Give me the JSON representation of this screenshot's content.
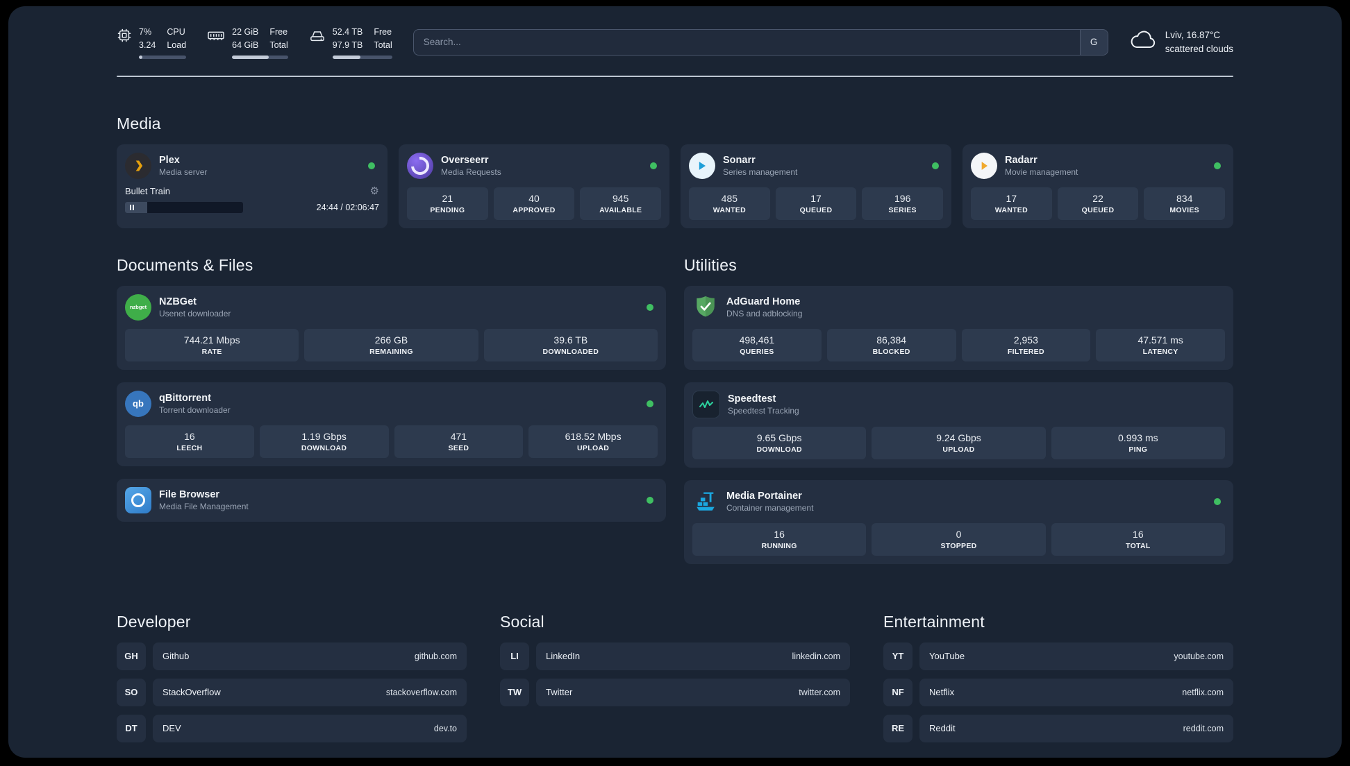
{
  "colors": {
    "page_bg": "#1a2433",
    "card_bg": "#242f41",
    "tile_bg": "#2d3a4e",
    "status_online": "#3fbf62",
    "plex_gold": "#e5a00d"
  },
  "header": {
    "cpu": {
      "percent": "7%",
      "load": "3.24",
      "col2_top": "CPU",
      "col2_bottom": "Load",
      "bar_percent": 7
    },
    "memory": {
      "free": "22 GiB",
      "total": "64 GiB",
      "col2_top": "Free",
      "col2_bottom": "Total",
      "bar_percent": 66
    },
    "disk": {
      "free": "52.4 TB",
      "total": "97.9 TB",
      "col2_top": "Free",
      "col2_bottom": "Total",
      "bar_percent": 47
    },
    "search": {
      "placeholder": "Search...",
      "provider_label": "G"
    },
    "weather": {
      "location": "Lviv, 16.87°C",
      "condition": "scattered clouds"
    }
  },
  "media": {
    "title": "Media",
    "plex": {
      "name": "Plex",
      "subtitle": "Media server",
      "now_playing": {
        "track": "Bullet Train",
        "time": "24:44 / 02:06:47",
        "progress_percent": 19
      }
    },
    "overseerr": {
      "name": "Overseerr",
      "subtitle": "Media Requests",
      "stats": [
        {
          "value": "21",
          "label": "PENDING"
        },
        {
          "value": "40",
          "label": "APPROVED"
        },
        {
          "value": "945",
          "label": "AVAILABLE"
        }
      ]
    },
    "sonarr": {
      "name": "Sonarr",
      "subtitle": "Series management",
      "stats": [
        {
          "value": "485",
          "label": "WANTED"
        },
        {
          "value": "17",
          "label": "QUEUED"
        },
        {
          "value": "196",
          "label": "SERIES"
        }
      ]
    },
    "radarr": {
      "name": "Radarr",
      "subtitle": "Movie management",
      "stats": [
        {
          "value": "17",
          "label": "WANTED"
        },
        {
          "value": "22",
          "label": "QUEUED"
        },
        {
          "value": "834",
          "label": "MOVIES"
        }
      ]
    }
  },
  "documents": {
    "title": "Documents & Files",
    "nzbget": {
      "name": "NZBGet",
      "subtitle": "Usenet downloader",
      "icon_text": "nzbget",
      "stats": [
        {
          "value": "744.21 Mbps",
          "label": "RATE"
        },
        {
          "value": "266 GB",
          "label": "REMAINING"
        },
        {
          "value": "39.6 TB",
          "label": "DOWNLOADED"
        }
      ]
    },
    "qbittorrent": {
      "name": "qBittorrent",
      "subtitle": "Torrent downloader",
      "icon_text": "qb",
      "stats": [
        {
          "value": "16",
          "label": "LEECH"
        },
        {
          "value": "1.19 Gbps",
          "label": "DOWNLOAD"
        },
        {
          "value": "471",
          "label": "SEED"
        },
        {
          "value": "618.52 Mbps",
          "label": "UPLOAD"
        }
      ]
    },
    "filebrowser": {
      "name": "File Browser",
      "subtitle": "Media File Management"
    }
  },
  "utilities": {
    "title": "Utilities",
    "adguard": {
      "name": "AdGuard Home",
      "subtitle": "DNS and adblocking",
      "stats": [
        {
          "value": "498,461",
          "label": "QUERIES"
        },
        {
          "value": "86,384",
          "label": "BLOCKED"
        },
        {
          "value": "2,953",
          "label": "FILTERED"
        },
        {
          "value": "47.571 ms",
          "label": "LATENCY"
        }
      ]
    },
    "speedtest": {
      "name": "Speedtest",
      "subtitle": "Speedtest Tracking",
      "stats": [
        {
          "value": "9.65 Gbps",
          "label": "DOWNLOAD"
        },
        {
          "value": "9.24 Gbps",
          "label": "UPLOAD"
        },
        {
          "value": "0.993 ms",
          "label": "PING"
        }
      ]
    },
    "portainer": {
      "name": "Media Portainer",
      "subtitle": "Container management",
      "stats": [
        {
          "value": "16",
          "label": "RUNNING"
        },
        {
          "value": "0",
          "label": "STOPPED"
        },
        {
          "value": "16",
          "label": "TOTAL"
        }
      ]
    }
  },
  "bookmarks": {
    "developer": {
      "title": "Developer",
      "items": [
        {
          "abbr": "GH",
          "name": "Github",
          "url": "github.com"
        },
        {
          "abbr": "SO",
          "name": "StackOverflow",
          "url": "stackoverflow.com"
        },
        {
          "abbr": "DT",
          "name": "DEV",
          "url": "dev.to"
        }
      ]
    },
    "social": {
      "title": "Social",
      "items": [
        {
          "abbr": "LI",
          "name": "LinkedIn",
          "url": "linkedin.com"
        },
        {
          "abbr": "TW",
          "name": "Twitter",
          "url": "twitter.com"
        }
      ]
    },
    "entertainment": {
      "title": "Entertainment",
      "items": [
        {
          "abbr": "YT",
          "name": "YouTube",
          "url": "youtube.com"
        },
        {
          "abbr": "NF",
          "name": "Netflix",
          "url": "netflix.com"
        },
        {
          "abbr": "RE",
          "name": "Reddit",
          "url": "reddit.com"
        }
      ]
    }
  }
}
